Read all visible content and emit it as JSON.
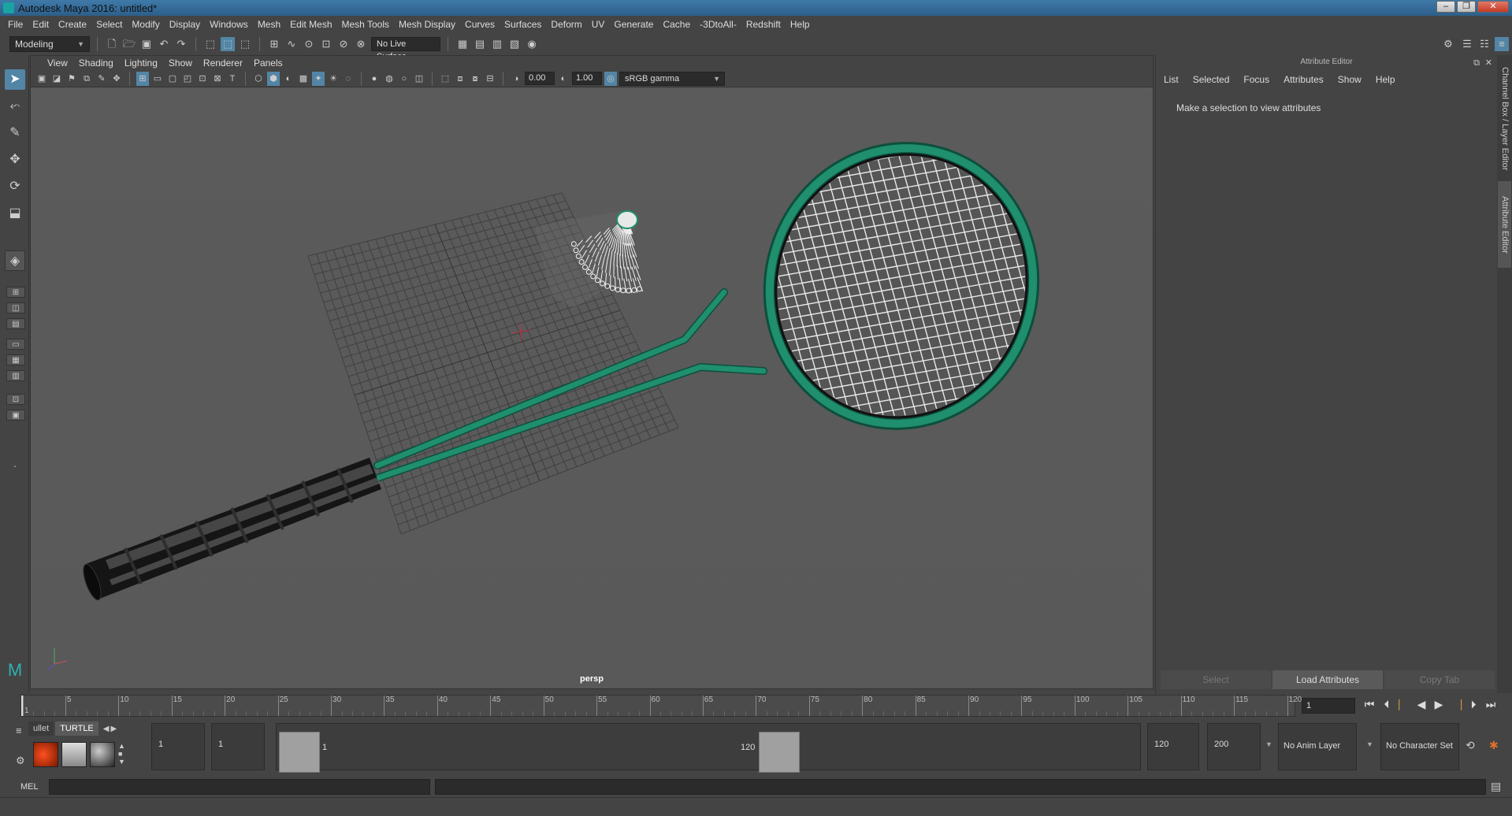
{
  "window": {
    "title": "Autodesk Maya 2016: untitled*",
    "controls": [
      "–",
      "❐",
      "✕"
    ]
  },
  "menubar": [
    "File",
    "Edit",
    "Create",
    "Select",
    "Modify",
    "Display",
    "Windows",
    "Mesh",
    "Edit Mesh",
    "Mesh Tools",
    "Mesh Display",
    "Curves",
    "Surfaces",
    "Deform",
    "UV",
    "Generate",
    "Cache",
    "-3DtoAll-",
    "Redshift",
    "Help"
  ],
  "status_line": {
    "mode": "Modeling",
    "live_surface": "No Live Surface"
  },
  "viewport": {
    "menu": [
      "View",
      "Shading",
      "Lighting",
      "Show",
      "Renderer",
      "Panels"
    ],
    "exposure": "0.00",
    "gamma_value": "1.00",
    "color_space": "sRGB gamma",
    "camera_label": "persp",
    "colors": {
      "racket": "#1f8f6e",
      "grid": "#404040",
      "grip": "#1a1a1a"
    }
  },
  "attribute_editor": {
    "title": "Attribute Editor",
    "menu": [
      "List",
      "Selected",
      "Focus",
      "Attributes",
      "Show",
      "Help"
    ],
    "message": "Make a selection to view attributes",
    "buttons": [
      "Select",
      "Load Attributes",
      "Copy Tab"
    ]
  },
  "side_tabs": [
    "Channel Box / Layer Editor",
    "Attribute Editor"
  ],
  "time_slider": {
    "ticks": [
      "1",
      "5",
      "10",
      "15",
      "20",
      "25",
      "30",
      "35",
      "40",
      "45",
      "50",
      "55",
      "60",
      "65",
      "70",
      "75",
      "80",
      "85",
      "90",
      "95",
      "100",
      "105",
      "110",
      "115",
      "120"
    ],
    "current_frame": "1"
  },
  "shelf": {
    "tabs": [
      "ullet",
      "TURTLE"
    ]
  },
  "range_slider": {
    "start_time": "1",
    "playback_start": "1",
    "range_start_label": "1",
    "range_end_label": "120",
    "playback_end": "120",
    "end_time": "200",
    "anim_layer": "No Anim Layer",
    "character_set": "No Character Set"
  },
  "command_line": {
    "language": "MEL"
  }
}
